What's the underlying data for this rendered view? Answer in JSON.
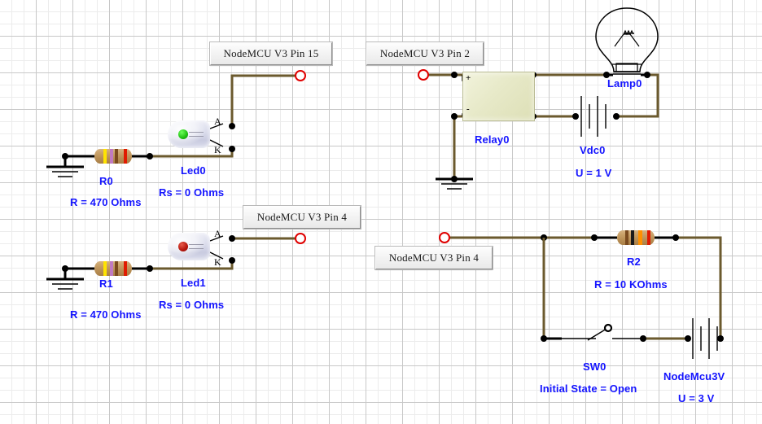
{
  "diagram": {
    "title": "NodeMCU V3 circuit schematic",
    "background_grid": true,
    "wire_color": "#6b5a2e",
    "lead_color": "#000000",
    "label_color": "#1414ff",
    "terminal_color": "#e00000"
  },
  "pin_labels": [
    {
      "id": "pin15",
      "text": "NodeMCU V3 Pin 15"
    },
    {
      "id": "pin2",
      "text": "NodeMCU V3 Pin 2"
    },
    {
      "id": "pin4a",
      "text": "NodeMCU V3 Pin 4"
    },
    {
      "id": "pin4b",
      "text": "NodeMCU V3 Pin 4"
    }
  ],
  "components": [
    {
      "id": "R0",
      "type": "resistor",
      "name": "R0",
      "value_label": "R = 470 Ohms",
      "bands": [
        "yellow",
        "violet",
        "brown",
        "red"
      ]
    },
    {
      "id": "Led0",
      "type": "led",
      "name": "Led0",
      "value_label": "Rs = 0 Ohms",
      "color": "green",
      "pins": {
        "anode": "A",
        "cathode": "K"
      }
    },
    {
      "id": "R1",
      "type": "resistor",
      "name": "R1",
      "value_label": "R = 470 Ohms",
      "bands": [
        "yellow",
        "violet",
        "brown",
        "red"
      ]
    },
    {
      "id": "Led1",
      "type": "led",
      "name": "Led1",
      "value_label": "Rs = 0 Ohms",
      "color": "red",
      "pins": {
        "anode": "A",
        "cathode": "K"
      }
    },
    {
      "id": "Relay0",
      "type": "relay",
      "name": "Relay0",
      "coil_plus": "+",
      "coil_minus": "-"
    },
    {
      "id": "Lamp0",
      "type": "lamp",
      "name": "Lamp0"
    },
    {
      "id": "Vdc0",
      "type": "battery",
      "name": "Vdc0",
      "value_label": "U = 1 V"
    },
    {
      "id": "R2",
      "type": "resistor",
      "name": "R2",
      "value_label": "R = 10 KOhms",
      "bands": [
        "brown",
        "black",
        "orange",
        "red"
      ]
    },
    {
      "id": "SW0",
      "type": "switch",
      "name": "SW0",
      "value_label": "Initial State =  Open"
    },
    {
      "id": "NodeMcu3V",
      "type": "battery",
      "name": "NodeMcu3V",
      "value_label": "U = 3 V"
    }
  ]
}
